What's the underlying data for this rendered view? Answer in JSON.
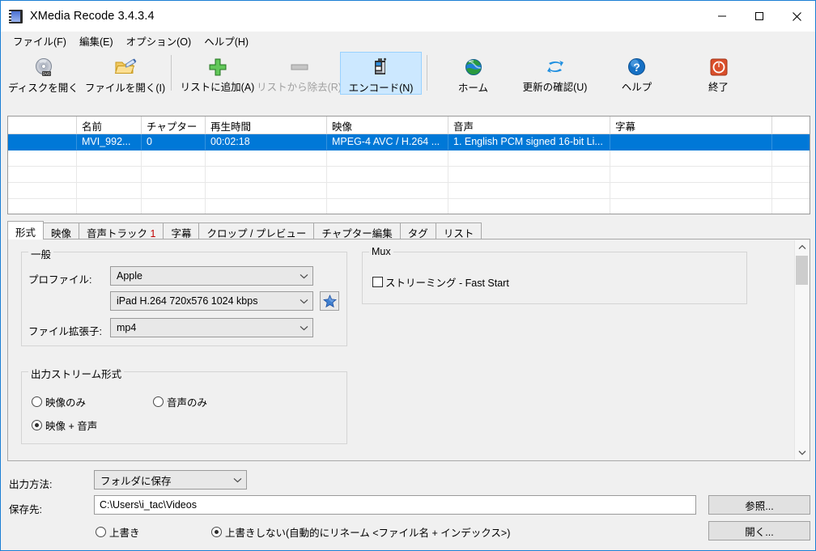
{
  "window": {
    "title": "XMedia Recode 3.4.3.4",
    "app_icon": "film-strip-icon",
    "minimize_label": "最小化",
    "maximize_label": "最大化",
    "close_label": "閉じる"
  },
  "menu": [
    {
      "label": "ファイル(F)",
      "name": "menu-file"
    },
    {
      "label": "編集(E)",
      "name": "menu-edit"
    },
    {
      "label": "オプション(O)",
      "name": "menu-options"
    },
    {
      "label": "ヘルプ(H)",
      "name": "menu-help"
    }
  ],
  "toolbar": [
    {
      "label": "ディスクを開く",
      "icon": "disc-icon",
      "state": "normal"
    },
    {
      "label": "ファイルを開く(I)",
      "icon": "open-folder-icon",
      "state": "normal"
    },
    {
      "sep": true
    },
    {
      "label": "リストに追加(A)",
      "icon": "plus-icon",
      "state": "normal"
    },
    {
      "label": "リストから除去(R)",
      "icon": "minus-icon",
      "state": "disabled"
    },
    {
      "label": "エンコード(N)",
      "icon": "encode-icon",
      "state": "selected"
    },
    {
      "sep": true
    },
    {
      "label": "ホーム",
      "icon": "globe-icon",
      "state": "normal"
    },
    {
      "label": "更新の確認(U)",
      "icon": "refresh-icon",
      "state": "normal"
    },
    {
      "label": "ヘルプ",
      "icon": "question-icon",
      "state": "normal"
    },
    {
      "label": "終了",
      "icon": "power-icon",
      "state": "normal"
    }
  ],
  "file_list": {
    "columns": [
      "",
      "名前",
      "チャプター",
      "再生時間",
      "映像",
      "音声",
      "字幕",
      ""
    ],
    "rows": [
      {
        "selected": true,
        "cells": [
          "",
          "MVI_992...",
          "0",
          "00:02:18",
          "MPEG-4 AVC / H.264 ...",
          "1. English PCM signed 16-bit Li...",
          "",
          ""
        ]
      }
    ],
    "empty_row_count": 4
  },
  "tabs": [
    {
      "label": "形式",
      "active": true
    },
    {
      "label": "映像",
      "active": false
    },
    {
      "label": "音声トラック ",
      "suffix": "1",
      "active": false
    },
    {
      "label": "字幕",
      "active": false
    },
    {
      "label": "クロップ / プレビュー",
      "active": false
    },
    {
      "label": "チャプター編集",
      "active": false
    },
    {
      "label": "タグ",
      "active": false
    },
    {
      "label": "リスト",
      "active": false
    }
  ],
  "format_panel": {
    "general": {
      "group_title": "一般",
      "profile_label": "プロファイル:",
      "profile_value": "Apple",
      "preset_value": "iPad H.264 720x576 1024 kbps",
      "favorite_icon": "star-icon",
      "extension_label": "ファイル拡張子:",
      "extension_value": "mp4"
    },
    "stream": {
      "group_title": "出力ストリーム形式",
      "options": [
        {
          "label": "映像のみ",
          "selected": false
        },
        {
          "label": "音声のみ",
          "selected": false
        },
        {
          "label": "映像 + 音声",
          "selected": true
        }
      ]
    },
    "mux": {
      "group_title": "Mux",
      "streaming_label": "ストリーミング - Fast Start",
      "streaming_checked": false
    },
    "scrollbar": {
      "up_icon": "chevron-up-icon",
      "down_icon": "chevron-down-icon"
    }
  },
  "output": {
    "method_label": "出力方法:",
    "method_value": "フォルダに保存",
    "dest_label": "保存先:",
    "dest_value": "C:\\Users\\i_tac\\Videos",
    "browse_label": "参照...",
    "open_label": "開く...",
    "overwrite_options": [
      {
        "label": "上書き",
        "selected": false
      },
      {
        "label": "上書きしない(自動的にリネーム <ファイル名 + インデックス>)",
        "selected": true
      }
    ]
  },
  "colors": {
    "accent": "#0078d7",
    "window_border": "#1a7fd4",
    "selected_toolbar": "#cce8ff",
    "face": "#f0f0f0"
  }
}
